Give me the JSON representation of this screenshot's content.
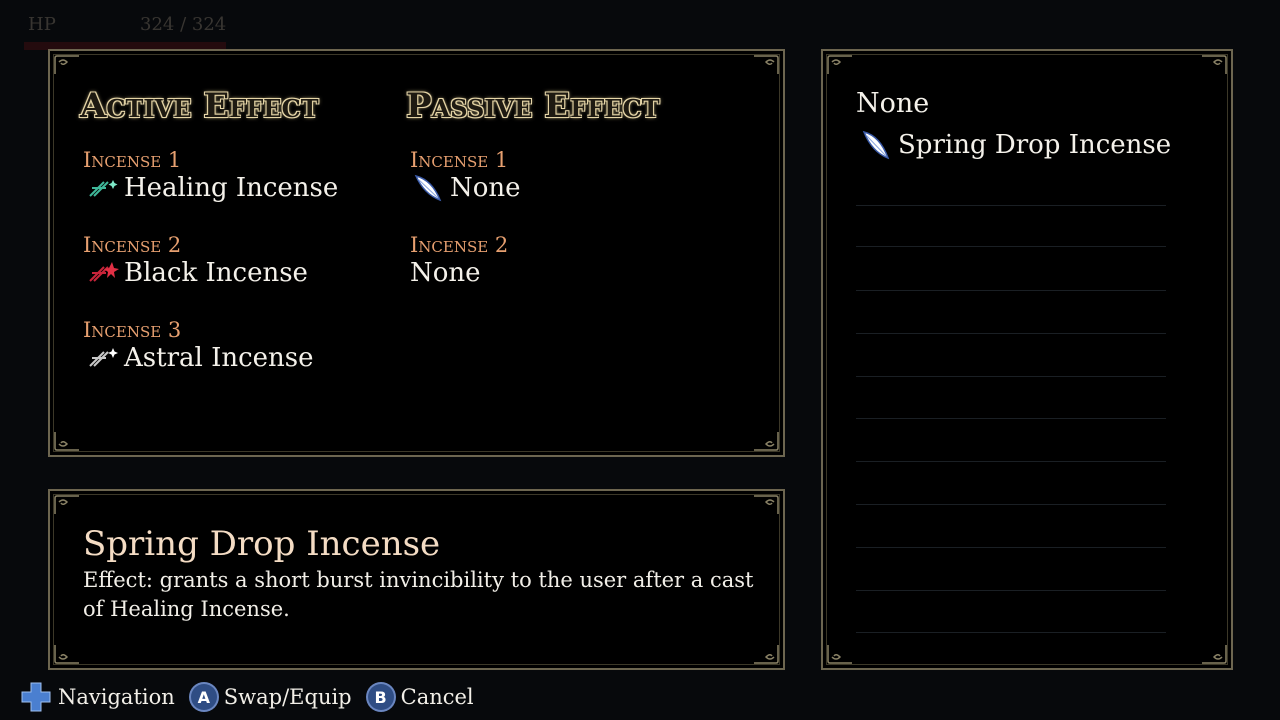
{
  "hud": {
    "hp_label": "HP",
    "hp_value": "324 / 324"
  },
  "effects": {
    "active_title": "Active Effect",
    "passive_title": "Passive Effect",
    "active": [
      {
        "label": "Incense 1",
        "value": "Healing Incense",
        "icon": "healing-incense-icon",
        "color": "#3fb89a"
      },
      {
        "label": "Incense 2",
        "value": "Black Incense",
        "icon": "black-incense-icon",
        "color": "#c8243a"
      },
      {
        "label": "Incense 3",
        "value": "Astral Incense",
        "icon": "astral-incense-icon",
        "color": "#cfcfcf"
      }
    ],
    "passive": [
      {
        "label": "Incense 1",
        "value": "None",
        "icon": "spring-drop-feather-icon"
      },
      {
        "label": "Incense 2",
        "value": "None"
      }
    ]
  },
  "description": {
    "title": "Spring Drop Incense",
    "text": "Effect: grants a short burst invincibility to the user after a cast of Healing Incense."
  },
  "inventory": {
    "none_label": "None",
    "items": [
      {
        "label": "Spring Drop Incense",
        "icon": "spring-drop-feather-icon"
      }
    ]
  },
  "footer": {
    "navigation": "Navigation",
    "a_key": "A",
    "a_label": "Swap/Equip",
    "b_key": "B",
    "b_label": "Cancel"
  },
  "colors": {
    "label_orange": "#e7a070",
    "frame_gold": "#6d6650",
    "button_blue": "#2f4d84"
  }
}
